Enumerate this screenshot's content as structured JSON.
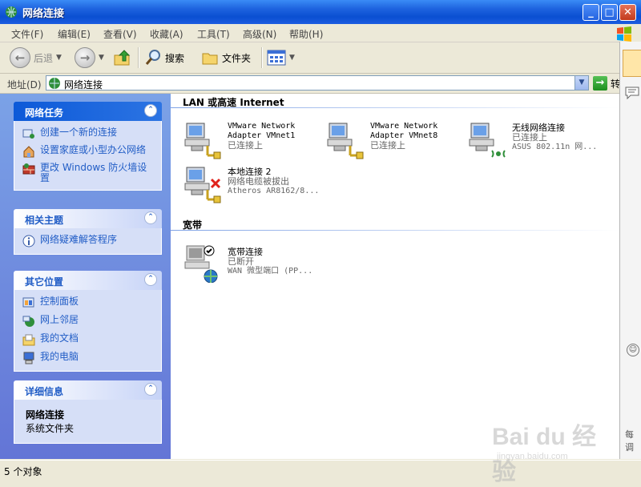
{
  "window": {
    "title": "网络连接"
  },
  "menu": [
    "文件(F)",
    "编辑(E)",
    "查看(V)",
    "收藏(A)",
    "工具(T)",
    "高级(N)",
    "帮助(H)"
  ],
  "toolbar": {
    "back": "后退",
    "search": "搜索",
    "folders": "文件夹"
  },
  "address": {
    "label": "地址(D)",
    "value": "网络连接",
    "go": "转"
  },
  "left_pane": {
    "network_tasks": {
      "title": "网络任务",
      "items": [
        {
          "label": "创建一个新的连接",
          "icon": "new-connection-icon"
        },
        {
          "label": "设置家庭或小型办公网络",
          "icon": "home-network-icon"
        },
        {
          "label": "更改 Windows 防火墙设置",
          "icon": "firewall-icon"
        }
      ]
    },
    "related": {
      "title": "相关主题",
      "items": [
        {
          "label": "网络疑难解答程序",
          "icon": "info-icon"
        }
      ]
    },
    "other_places": {
      "title": "其它位置",
      "items": [
        {
          "label": "控制面板",
          "icon": "control-panel-icon"
        },
        {
          "label": "网上邻居",
          "icon": "network-places-icon"
        },
        {
          "label": "我的文档",
          "icon": "my-documents-icon"
        },
        {
          "label": "我的电脑",
          "icon": "my-computer-icon"
        }
      ]
    },
    "details": {
      "title": "详细信息",
      "name": "网络连接",
      "type": "系统文件夹"
    }
  },
  "content": {
    "lan_group": "LAN 或高速 Internet",
    "broadband_group": "宽带",
    "connections": [
      {
        "name_line1": "VMware Network",
        "name_line2": "Adapter VMnet1",
        "status": "已连接上",
        "device": ""
      },
      {
        "name_line1": "VMware Network",
        "name_line2": "Adapter VMnet8",
        "status": "已连接上",
        "device": ""
      },
      {
        "name_line1": "无线网络连接",
        "name_line2": "",
        "status": "已连接上",
        "device": "ASUS 802.11n 网..."
      },
      {
        "name_line1": "本地连接 2",
        "name_line2": "",
        "status": "网络电缆被拔出",
        "device": "Atheros AR8162/8..."
      },
      {
        "name_line1": "宽带连接",
        "name_line2": "",
        "status": "已断开",
        "device": "WAN 微型端口 (PP..."
      }
    ]
  },
  "right_strip": {
    "text": "每调"
  },
  "status": {
    "text": "5 个对象"
  },
  "watermark": {
    "logo": "Bai du 经验",
    "url": "jingyan.baidu.com"
  },
  "colors": {
    "titlebar": "#0a4fd1",
    "pane": "#7ba2e7",
    "link": "#215dc6"
  }
}
